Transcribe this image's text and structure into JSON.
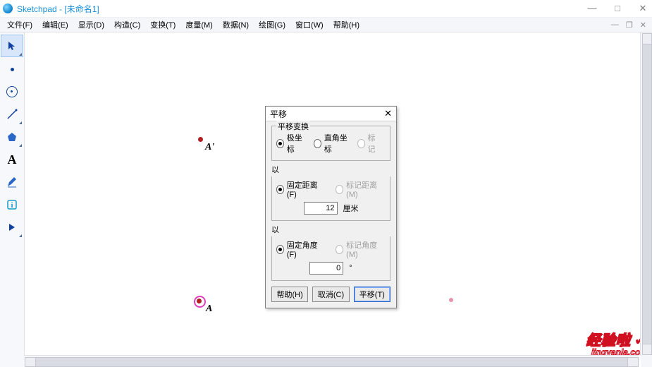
{
  "app": {
    "title": "Sketchpad  - [未命名1]"
  },
  "window": {
    "min": "—",
    "max": "□",
    "close": "✕",
    "sub_min": "—",
    "sub_max": "❐",
    "sub_close": "✕"
  },
  "menu": {
    "items": [
      "文件(F)",
      "编辑(E)",
      "显示(D)",
      "构造(C)",
      "变换(T)",
      "度量(M)",
      "数据(N)",
      "绘图(G)",
      "窗口(W)",
      "帮助(H)"
    ]
  },
  "tools": {
    "names": [
      "arrow",
      "point",
      "circle",
      "line",
      "polygon",
      "text",
      "pen",
      "info",
      "play"
    ]
  },
  "canvas": {
    "points": {
      "Aprime": {
        "label": "A'"
      },
      "A": {
        "label": "A"
      }
    }
  },
  "dialog": {
    "title": "平移",
    "group_transform": "平移变换",
    "opt_polar": "极坐标",
    "opt_cart": "直角坐标",
    "opt_mark": "标记",
    "by1": "以",
    "opt_fixed_dist": "固定距离(F)",
    "opt_mark_dist": "标记距离(M)",
    "dist_value": "12",
    "dist_unit": "厘米",
    "by2": "以",
    "opt_fixed_angle": "固定角度(F)",
    "opt_mark_angle": "标记角度(M)",
    "angle_value": "0",
    "angle_unit": "°",
    "btn_help": "帮助(H)",
    "btn_cancel": "取消(C)",
    "btn_ok": "平移(T)"
  },
  "watermark": {
    "text": "经验啦",
    "check": "✓",
    "url": "jingyanla.com"
  }
}
